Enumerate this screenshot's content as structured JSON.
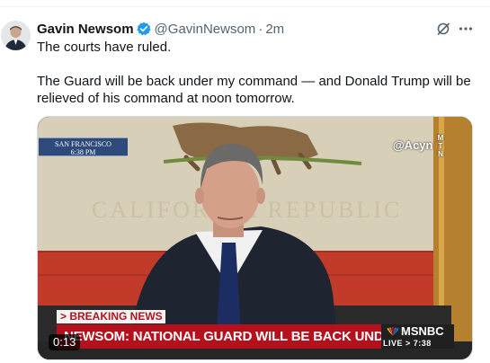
{
  "tweet": {
    "author_name": "Gavin Newsom",
    "handle": "@GavinNewsom",
    "separator": "·",
    "time": "2m",
    "verified_icon": "verified-badge-icon",
    "text_line1": "The courts have ruled.",
    "text_line2": "The Guard will be back under my command — and Donald Trump will be relieved of his command at noon tomorrow."
  },
  "actions": {
    "grok_icon": "grok-icon",
    "more_icon": "more-dots-icon"
  },
  "video": {
    "duration": "0:13",
    "location_line1": "SAN FRANCISCO",
    "location_line2": "6:38 PM",
    "watermark": "@Acyn",
    "watermark_tag": "M\nT\nN",
    "breaking_label": "> BREAKING NEWS",
    "chyron": "NEWSOM: NATIONAL GUARD WILL BE BACK UNDER MY COMMAND",
    "network": "MSNBC",
    "live_label": "LIVE > 7:38"
  },
  "colors": {
    "verified_blue": "#1d9bf0",
    "chyron_red": "#b5111d",
    "secondary_text": "#536471"
  }
}
